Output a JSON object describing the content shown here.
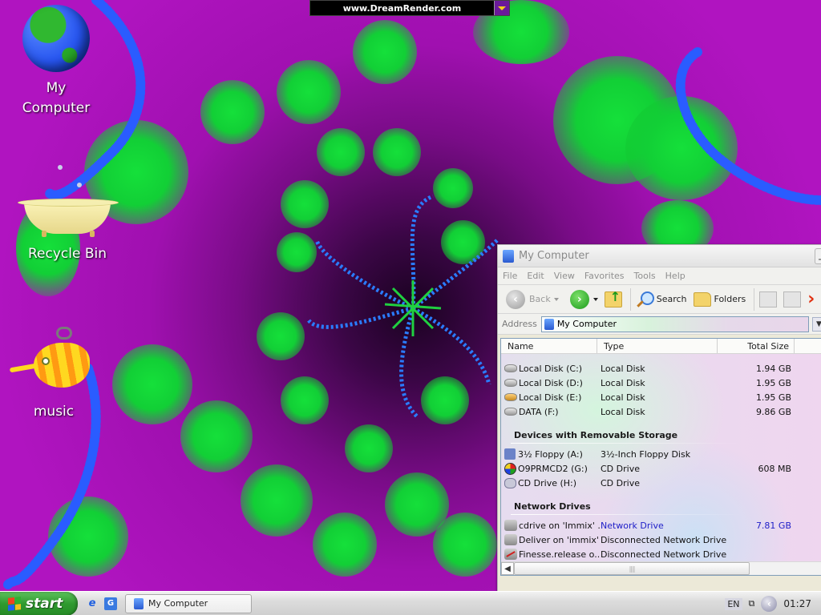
{
  "top_bar": {
    "text": "www.DreamRender.com"
  },
  "desktop": {
    "icons": [
      {
        "label_line1": "My",
        "label_line2": "Computer",
        "icon": "globe-icon"
      },
      {
        "label": "Recycle Bin",
        "icon": "bathtub-icon"
      },
      {
        "label": "music",
        "icon": "fish-icon"
      }
    ]
  },
  "window": {
    "title": "My Computer",
    "menu": [
      "File",
      "Edit",
      "View",
      "Favorites",
      "Tools",
      "Help"
    ],
    "toolbar": {
      "back_label": "Back",
      "search_label": "Search",
      "folders_label": "Folders"
    },
    "address": {
      "label": "Address",
      "value": "My Computer"
    },
    "columns": [
      "Name",
      "Type",
      "Total Size"
    ],
    "groups": [
      {
        "heading": "",
        "items": [
          {
            "name": "Local Disk (C:)",
            "type": "Local Disk",
            "size": "1.94 GB",
            "icon": "hard-drive-icon"
          },
          {
            "name": "Local Disk (D:)",
            "type": "Local Disk",
            "size": "1.95 GB",
            "icon": "hard-drive-icon"
          },
          {
            "name": "Local Disk (E:)",
            "type": "Local Disk",
            "size": "1.95 GB",
            "icon": "shared-drive-icon"
          },
          {
            "name": "DATA (F:)",
            "type": "Local Disk",
            "size": "9.86 GB",
            "icon": "hard-drive-icon"
          }
        ]
      },
      {
        "heading": "Devices with Removable Storage",
        "items": [
          {
            "name": "3½ Floppy (A:)",
            "type": "3½-Inch Floppy Disk",
            "size": "",
            "icon": "floppy-icon"
          },
          {
            "name": "O9PRMCD2 (G:)",
            "type": "CD Drive",
            "size": "608 MB",
            "icon": "cd-icon"
          },
          {
            "name": "CD Drive (H:)",
            "type": "CD Drive",
            "size": "",
            "icon": "cd-drive-icon"
          }
        ]
      },
      {
        "heading": "Network Drives",
        "items": [
          {
            "name": "cdrive on 'Immix' ...",
            "type": "Network Drive",
            "size": "7.81 GB",
            "icon": "network-drive-icon"
          },
          {
            "name": "Deliver on 'immix' ...",
            "type": "Disconnected Network Drive",
            "size": "",
            "icon": "network-drive-icon"
          },
          {
            "name": "Finesse.release o...",
            "type": "Disconnected Network Drive",
            "size": "",
            "icon": "disconnected-network-drive-icon"
          }
        ]
      }
    ]
  },
  "taskbar": {
    "start_label": "start",
    "task_button": "My Computer",
    "language": "EN",
    "clock": "01:27"
  }
}
